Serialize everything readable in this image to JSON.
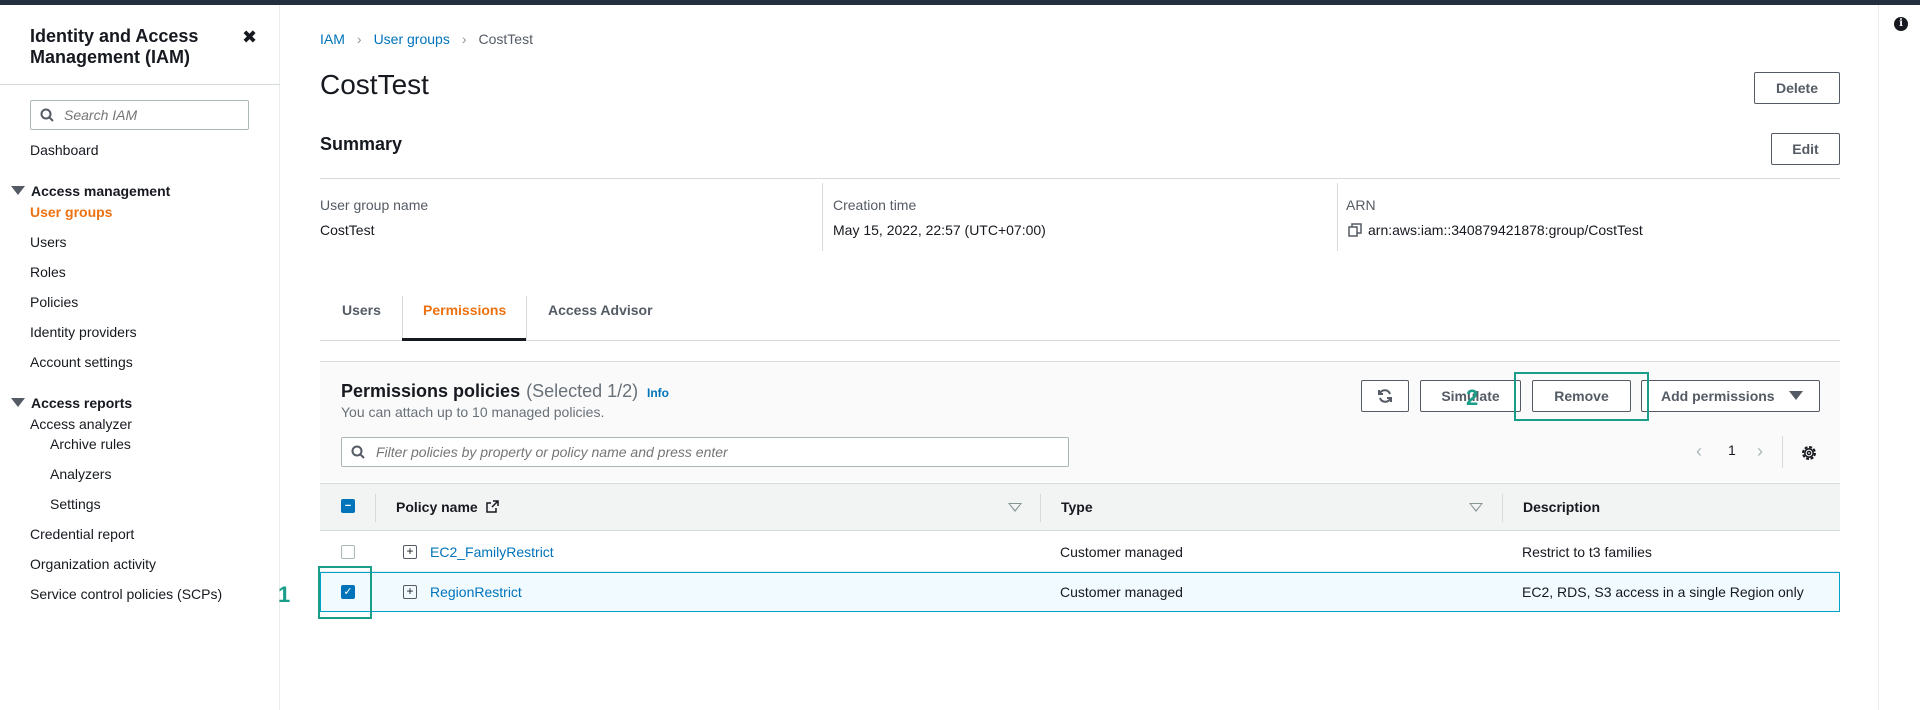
{
  "sidebar": {
    "title": "Identity and Access Management (IAM)",
    "search_placeholder": "Search IAM",
    "dashboard": "Dashboard",
    "access_management": {
      "label": "Access management",
      "items": [
        "User groups",
        "Users",
        "Roles",
        "Policies",
        "Identity providers",
        "Account settings"
      ]
    },
    "access_reports": {
      "label": "Access reports",
      "analyzer": "Access analyzer",
      "analyzer_items": [
        "Archive rules",
        "Analyzers",
        "Settings"
      ],
      "items": [
        "Credential report",
        "Organization activity",
        "Service control policies (SCPs)"
      ]
    }
  },
  "breadcrumbs": [
    "IAM",
    "User groups",
    "CostTest"
  ],
  "page": {
    "title": "CostTest",
    "delete_label": "Delete"
  },
  "summary": {
    "heading": "Summary",
    "edit_label": "Edit",
    "group_name_label": "User group name",
    "group_name": "CostTest",
    "creation_label": "Creation time",
    "creation_time": "May 15, 2022, 22:57 (UTC+07:00)",
    "arn_label": "ARN",
    "arn": "arn:aws:iam::340879421878:group/CostTest"
  },
  "tabs": [
    "Users",
    "Permissions",
    "Access Advisor"
  ],
  "permissions": {
    "title": "Permissions policies",
    "selected": "(Selected 1/2)",
    "info": "Info",
    "description": "You can attach up to 10 managed policies.",
    "simulate_label": "Simulate",
    "remove_label": "Remove",
    "add_label": "Add permissions",
    "filter_placeholder": "Filter policies by property or policy name and press enter",
    "page": "1",
    "columns": [
      "Policy name",
      "Type",
      "Description"
    ],
    "rows": [
      {
        "name": "EC2_FamilyRestrict",
        "type": "Customer managed",
        "description": "Restrict to t3 families",
        "selected": false
      },
      {
        "name": "RegionRestrict",
        "type": "Customer managed",
        "description": "EC2, RDS, S3 access in a single Region only",
        "selected": true
      }
    ]
  },
  "annotations": [
    "1",
    "2"
  ],
  "colors": {
    "accent": "#ec7211",
    "link": "#0073bb",
    "annotation": "#1a9e8a"
  }
}
